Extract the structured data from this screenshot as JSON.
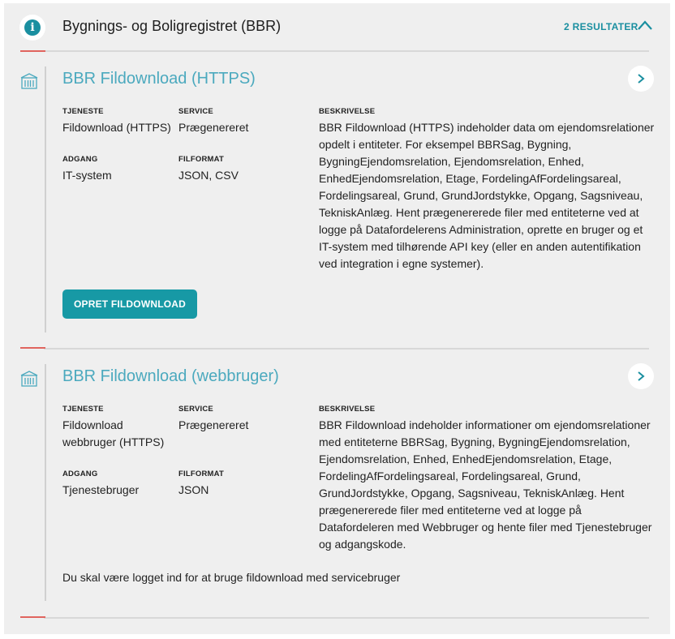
{
  "header": {
    "title": "Bygnings- og Boligregistret (BBR)",
    "results_label": "2 RESULTATER",
    "info_icon_glyph": "i"
  },
  "colors": {
    "accent": "#1a8fa0",
    "link_title": "#4ba9be",
    "button_bg": "#1799a5",
    "red_marker": "#e0645e",
    "panel_bg": "#efefef"
  },
  "results": [
    {
      "title": "BBR Fildownload (HTTPS)",
      "tjeneste_label": "TJENESTE",
      "tjeneste": "Fildownload (HTTPS)",
      "service_label": "SERVICE",
      "service": "Prægenereret",
      "adgang_label": "ADGANG",
      "adgang": "IT-system",
      "filformat_label": "FILFORMAT",
      "filformat": "JSON, CSV",
      "beskrivelse_label": "BESKRIVELSE",
      "beskrivelse": "BBR Fildownload (HTTPS) indeholder data om ejendomsrelationer opdelt i entiteter. For eksempel BBRSag, Bygning, BygningEjendomsrelation, Ejendomsrelation, Enhed, EnhedEjendomsrelation, Etage, FordelingAfFordelingsareal, Fordelingsareal, Grund, GrundJordstykke, Opgang, Sagsniveau, TekniskAnlæg. Hent prægenererede filer med entiteterne ved at logge på Datafordelerens Administration, oprette en bruger og et IT-system med tilhørende API key (eller en anden autentifikation ved integration i egne systemer).",
      "button_label": "OPRET FILDOWNLOAD"
    },
    {
      "title": "BBR Fildownload (webbruger)",
      "tjeneste_label": "TJENESTE",
      "tjeneste": "Fildownload webbruger (HTTPS)",
      "service_label": "SERVICE",
      "service": "Prægenereret",
      "adgang_label": "ADGANG",
      "adgang": "Tjenestebruger",
      "filformat_label": "FILFORMAT",
      "filformat": "JSON",
      "beskrivelse_label": "BESKRIVELSE",
      "beskrivelse": "BBR Fildownload indeholder informationer om ejendomsrelationer med entiteterne BBRSag, Bygning, BygningEjendomsrelation, Ejendomsrelation, Enhed, EnhedEjendomsrelation, Etage, FordelingAfFordelingsareal, Fordelingsareal, Grund, GrundJordstykke, Opgang, Sagsniveau, TekniskAnlæg. Hent prægenererede filer med entiteterne ved at logge på Datafordeleren med Webbruger og hente filer med Tjenestebruger og adgangskode.",
      "note": "Du skal være logget ind for at bruge fildownload med servicebruger"
    }
  ]
}
